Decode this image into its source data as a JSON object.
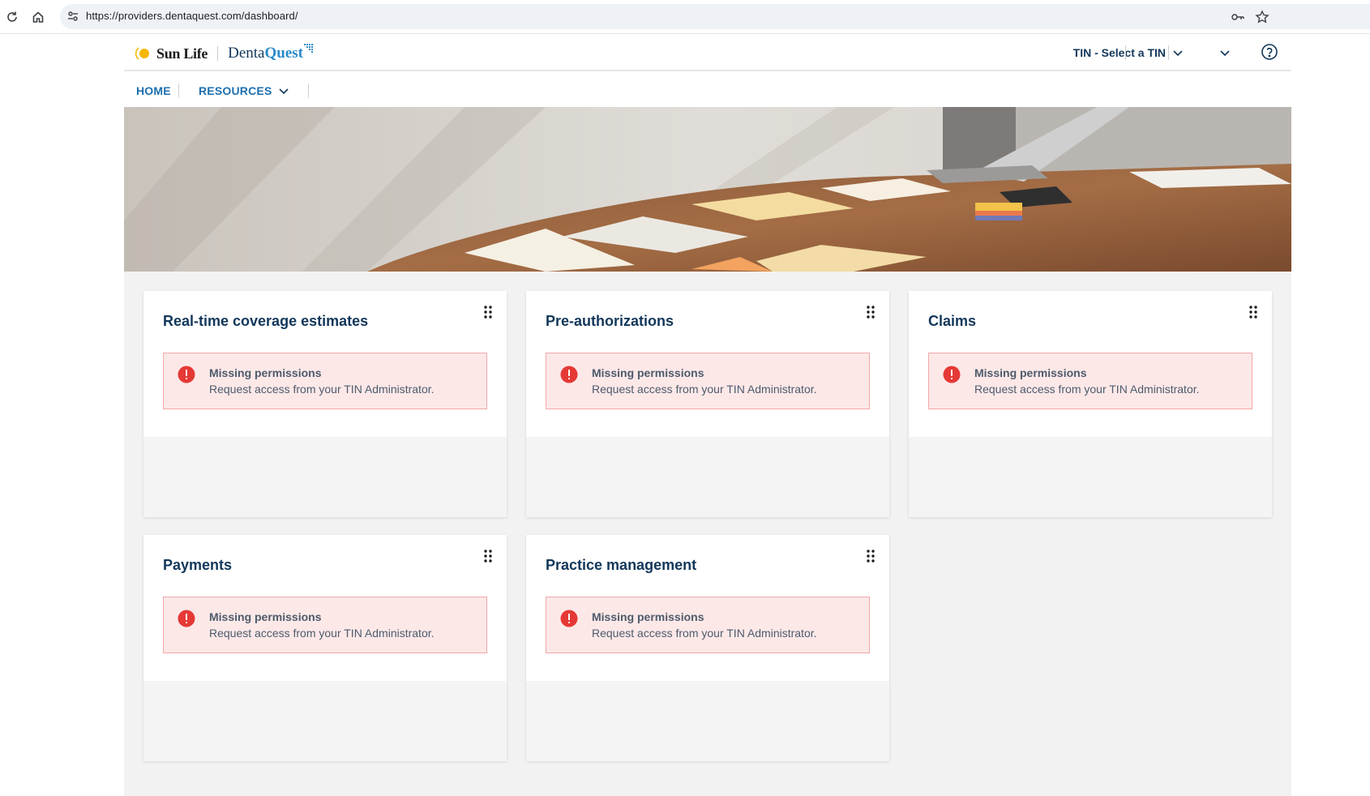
{
  "browser": {
    "url": "https://providers.dentaquest.com/dashboard/"
  },
  "header": {
    "logo_sunlife": "Sun Life",
    "logo_denta": "Denta",
    "logo_quest": "Quest",
    "tin_label": "TIN - Select a TIN"
  },
  "nav": {
    "home": "HOME",
    "resources": "RESOURCES"
  },
  "colors": {
    "brand_navy": "#12375a",
    "link_blue": "#1c6fb0",
    "alert_bg": "#fde8e8",
    "alert_icon": "#e53935"
  },
  "cards": [
    {
      "title": "Real-time coverage estimates",
      "alert_title": "Missing permissions",
      "alert_text": "Request access from your TIN Administrator."
    },
    {
      "title": "Pre-authorizations",
      "alert_title": "Missing permissions",
      "alert_text": "Request access from your TIN Administrator."
    },
    {
      "title": "Claims",
      "alert_title": "Missing permissions",
      "alert_text": "Request access from your TIN Administrator."
    },
    {
      "title": "Payments",
      "alert_title": "Missing permissions",
      "alert_text": "Request access from your TIN Administrator."
    },
    {
      "title": "Practice management",
      "alert_title": "Missing permissions",
      "alert_text": "Request access from your TIN Administrator."
    }
  ]
}
